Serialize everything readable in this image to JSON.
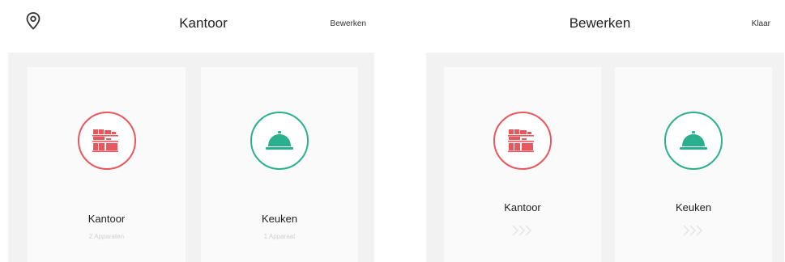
{
  "left_screen": {
    "title": "Kantoor",
    "edit_label": "Bewerken",
    "location_icon": "location-pin-icon",
    "rooms": [
      {
        "name": "Kantoor",
        "subtitle": "2 Apparaten",
        "icon": "office-furniture-icon",
        "color": "#e8575d"
      },
      {
        "name": "Keuken",
        "subtitle": "1 Apparaat",
        "icon": "food-cloche-icon",
        "color": "#2bb08e"
      }
    ]
  },
  "right_screen": {
    "title": "Bewerken",
    "done_label": "Klaar",
    "rooms": [
      {
        "name": "Kantoor",
        "icon": "office-furniture-icon",
        "action_icon": "chevrons-right-icon",
        "color": "#e8575d"
      },
      {
        "name": "Keuken",
        "icon": "food-cloche-icon",
        "action_icon": "chevrons-right-icon",
        "color": "#2bb08e"
      }
    ]
  }
}
